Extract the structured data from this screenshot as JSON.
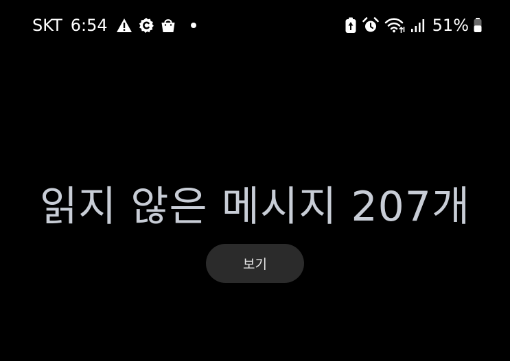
{
  "status_bar": {
    "carrier": "SKT",
    "time": "6:54",
    "left_icons": [
      "warning-icon",
      "c-badge-icon",
      "shopping-bag-icon",
      "dot-icon"
    ],
    "right_icons": [
      "battery-saver-icon",
      "alarm-icon",
      "wifi-icon",
      "signal-icon",
      "battery-icon"
    ],
    "battery_percent": "51%",
    "battery_level": 0.51
  },
  "main": {
    "headline": "읽지 않은 메시지 207개",
    "view_button_label": "보기"
  },
  "colors": {
    "background": "#000000",
    "headline_text": "#c8cdd6",
    "button_background": "#2b2b2b",
    "button_text": "#e6e6e6"
  }
}
